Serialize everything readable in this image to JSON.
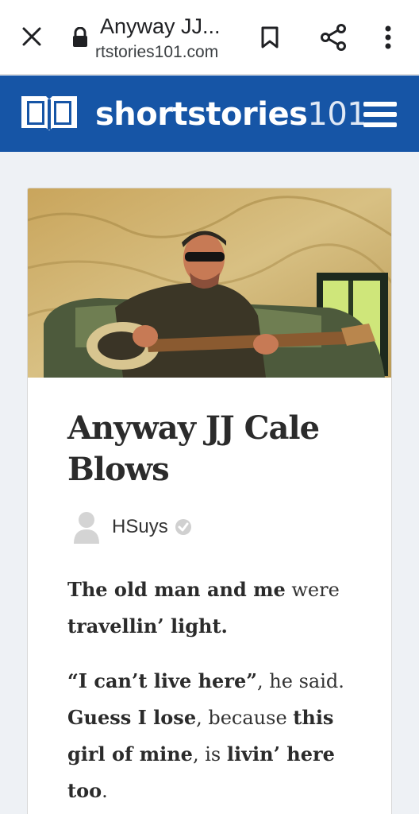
{
  "browser": {
    "tab_title": "Anyway JJ...",
    "url": "rtstories101.com"
  },
  "site": {
    "name_bold": "shortstories",
    "name_light": "101",
    "brand_color": "#1655a6"
  },
  "story": {
    "title": "Anyway JJ Cale Blows",
    "author": "HSuys",
    "paragraphs": [
      [
        {
          "text": "The old man and me",
          "bold": true
        },
        {
          "text": " were ",
          "bold": false
        },
        {
          "text": "travellin’ light.",
          "bold": true
        }
      ],
      [
        {
          "text": "“I can’t live here”",
          "bold": true
        },
        {
          "text": ", he said. ",
          "bold": false
        },
        {
          "text": "Guess I lose",
          "bold": true
        },
        {
          "text": ", because ",
          "bold": false
        },
        {
          "text": "this girl of mine",
          "bold": true
        },
        {
          "text": ", is ",
          "bold": false
        },
        {
          "text": "livin’ here too",
          "bold": true
        },
        {
          "text": ".",
          "bold": false
        }
      ]
    ]
  },
  "icons": [
    "close-icon",
    "lock-icon",
    "bookmark-icon",
    "share-icon",
    "more-vert-icon",
    "book-logo-icon",
    "hamburger-menu-icon",
    "avatar-icon",
    "verified-icon"
  ]
}
